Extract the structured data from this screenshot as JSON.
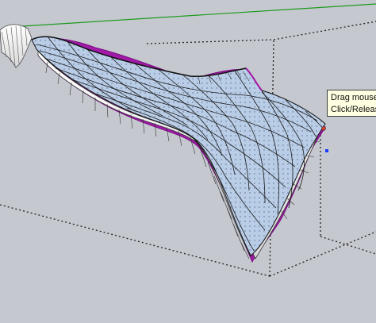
{
  "tooltip": {
    "line1": "Drag mouse t",
    "line2": "Click/Release"
  },
  "colors": {
    "background": "#c6c8d0",
    "axis_green": "#1e9a1e",
    "surface_fill": "#b9cde6",
    "surface_mesh": "#1b1b1b",
    "edge_magenta": "#a21aa8",
    "bounding_box": "#222222",
    "tooltip_bg": "#ffffe1",
    "cursor_blue": "#1a3cff"
  }
}
